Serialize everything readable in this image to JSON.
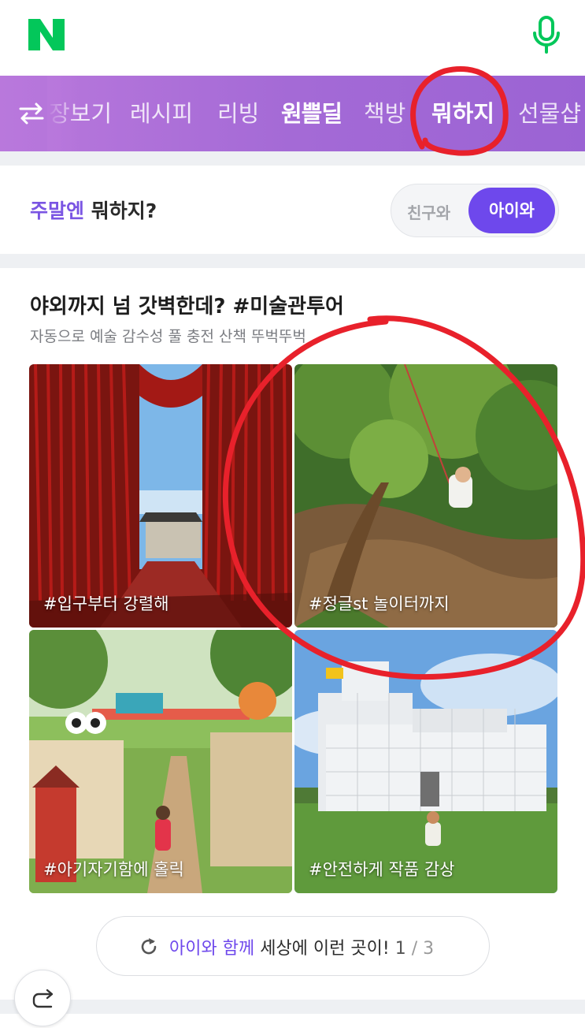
{
  "header": {
    "logo_text": "N",
    "logo_icon": "naver-logo-icon",
    "mic_icon": "microphone-icon"
  },
  "tabs": {
    "toggle_icon": "swap-arrows-icon",
    "items": [
      {
        "label": "장보기",
        "state": "partial"
      },
      {
        "label": "레시피",
        "state": "normal"
      },
      {
        "label": "리빙",
        "state": "normal"
      },
      {
        "label": "원쁠딜",
        "state": "special"
      },
      {
        "label": "책방",
        "state": "normal"
      },
      {
        "label": "뭐하지",
        "state": "active"
      },
      {
        "label": "선물샵",
        "state": "partial"
      }
    ]
  },
  "weekend": {
    "title_highlight": "주말엔",
    "title_rest": "뭐하지?",
    "segment_off": "친구와",
    "segment_on": "아이와"
  },
  "art": {
    "title": "야외까지 넘 갓벽한데? #미술관투어",
    "subtitle": "자동으로 예술 감수성 풀 충전 산책 뚜벅뚜벅",
    "cards": [
      {
        "label": "#입구부터 강렬해"
      },
      {
        "label": "#정글st 놀이터까지"
      },
      {
        "label": "#아기자기함에 홀릭"
      },
      {
        "label": "#안전하게 작품 감상"
      }
    ],
    "refresh": {
      "icon": "refresh-icon",
      "highlight": "아이와 함께",
      "text": "세상에 이런 곳이!",
      "page": "1",
      "separator": "/",
      "total": "3"
    }
  },
  "share_fab_icon": "share-arrow-icon",
  "colors": {
    "brand_green": "#03c75a",
    "tab_purple": "#a46ad6",
    "accent_purple": "#6e48ec",
    "annotation_red": "#e8212b"
  }
}
